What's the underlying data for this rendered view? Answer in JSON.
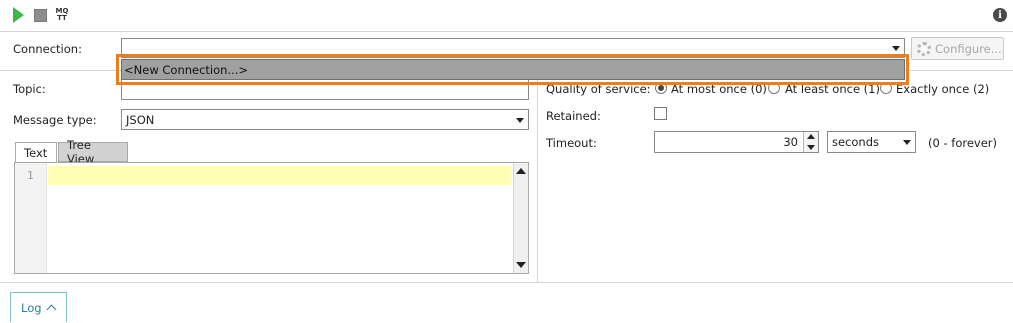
{
  "toolbar": {
    "play_icon": "play-icon",
    "stop_icon": "stop-icon",
    "mqtt_icon_text": "MQ\nTT",
    "info_icon": "info-icon"
  },
  "connection": {
    "label": "Connection:",
    "value": "",
    "dropdown_options": [
      "<New Connection...>"
    ],
    "configure_label": "Configure..."
  },
  "topic": {
    "label": "Topic:",
    "value": ""
  },
  "message_type": {
    "label": "Message type:",
    "value": "JSON"
  },
  "editor": {
    "tabs": [
      {
        "label": "Text",
        "active": true
      },
      {
        "label": "Tree View",
        "active": false
      }
    ],
    "line_numbers": [
      "1"
    ]
  },
  "qos": {
    "label": "Quality of service:",
    "options": [
      {
        "label": "At most once (0)",
        "selected": true
      },
      {
        "label": "At least once (1)",
        "selected": false
      },
      {
        "label": "Exactly once (2)",
        "selected": false
      }
    ]
  },
  "retained": {
    "label": "Retained:",
    "checked": false
  },
  "timeout": {
    "label": "Timeout:",
    "value": "30",
    "unit": "seconds",
    "hint": "(0 - forever)"
  },
  "bottom": {
    "log_label": "Log"
  },
  "colors": {
    "highlight": "#ee7d1a",
    "play": "#3fb54a",
    "log_text": "#2e7da3"
  }
}
